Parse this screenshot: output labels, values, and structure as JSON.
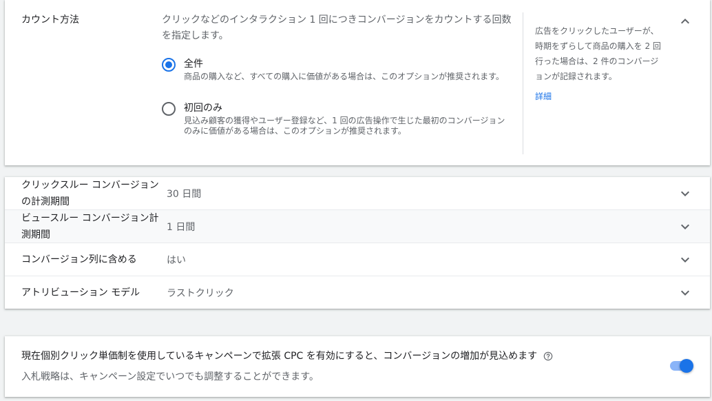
{
  "count_section": {
    "label": "カウント方法",
    "description": "クリックなどのインタラクション 1 回につきコンバージョンをカウントする回数を指定します。",
    "options": [
      {
        "title": "全件",
        "subtitle": "商品の購入など、すべての購入に価値がある場合は、このオプションが推奨されます。",
        "selected": true
      },
      {
        "title": "初回のみ",
        "subtitle": "見込み顧客の獲得やユーザー登録など、1 回の広告操作で生じた最初のコンバージョンのみに価値がある場合は、このオプションが推奨されます。",
        "selected": false
      }
    ],
    "help_text": "広告をクリックしたユーザーが、時期をずらして商品の購入を 2 回行った場合は、2 件のコンバージョンが記録されます。",
    "help_link": "詳細",
    "collapse_icon": "chevron-up-icon"
  },
  "settings_rows": [
    {
      "label": "クリックスルー コンバージョンの計測期間",
      "value": "30 日間"
    },
    {
      "label": "ビュースルー コンバージョン計測期間",
      "value": "1 日間"
    },
    {
      "label": "コンバージョン列に含める",
      "value": "はい"
    },
    {
      "label": "アトリビューション モデル",
      "value": "ラストクリック"
    }
  ],
  "ecpc": {
    "title": "現在個別クリック単価制を使用しているキャンペーンで拡張 CPC を有効にすると、コンバージョンの増加が見込めます",
    "subtitle": "入札戦略は、キャンペーン設定でいつでも調整することができます。",
    "toggle_on": true
  },
  "colors": {
    "accent": "#1a73e8",
    "toggle_track": "#8ab4f8",
    "background": "#f1f3f4"
  }
}
